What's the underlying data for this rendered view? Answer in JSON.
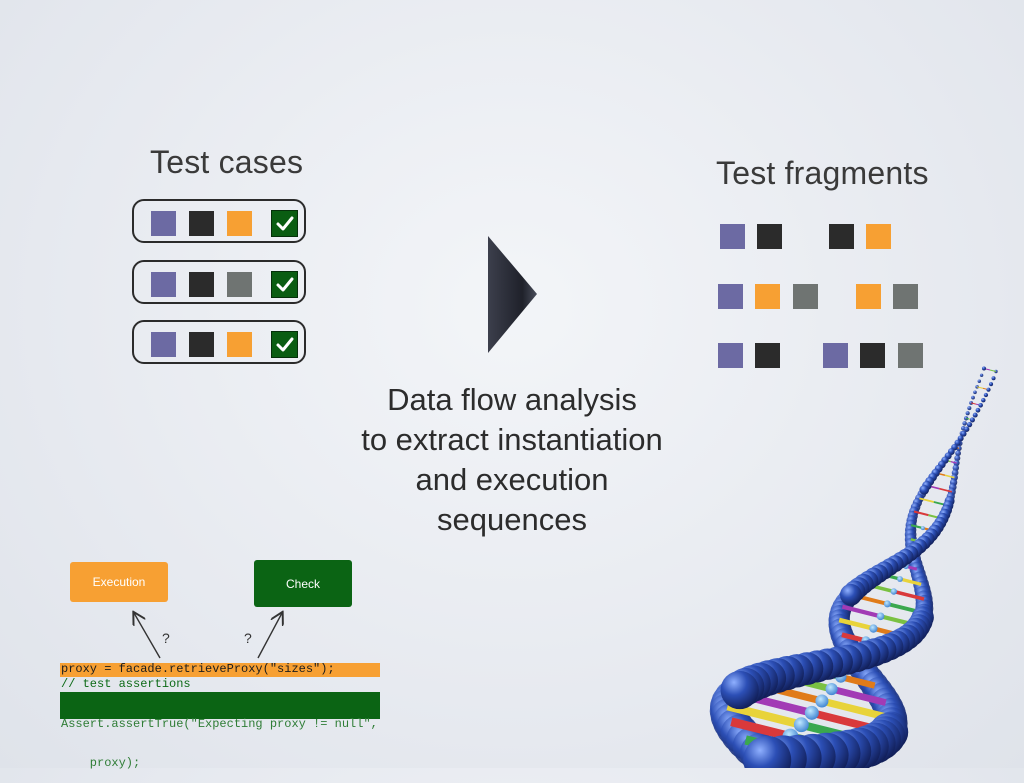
{
  "test_cases": {
    "title": "Test cases",
    "rows": [
      {
        "squares": [
          "purple",
          "black",
          "orange"
        ]
      },
      {
        "squares": [
          "purple",
          "black",
          "gray"
        ]
      },
      {
        "squares": [
          "purple",
          "black",
          "orange"
        ]
      }
    ],
    "check_icon": "checkmark-icon"
  },
  "test_fragments": {
    "title": "Test fragments"
  },
  "caption": {
    "line1": "Data flow analysis",
    "line2": "to extract instantiation",
    "line3": "and execution",
    "line4": "sequences"
  },
  "flow": {
    "execution_label": "Execution",
    "check_label": "Check",
    "question1": "?",
    "question2": "?",
    "code_line1": "proxy = facade.retrieveProxy(\"sizes\");",
    "code_line2": "// test assertions",
    "code_line3": "Assert.assertTrue(\"Expecting proxy != null\",",
    "code_line4": "    proxy);"
  },
  "colors": {
    "purple": "#6c6aa3",
    "black": "#2b2b2b",
    "orange": "#f7a033",
    "gray": "#6f7472",
    "check_green": "#0a5d12"
  }
}
